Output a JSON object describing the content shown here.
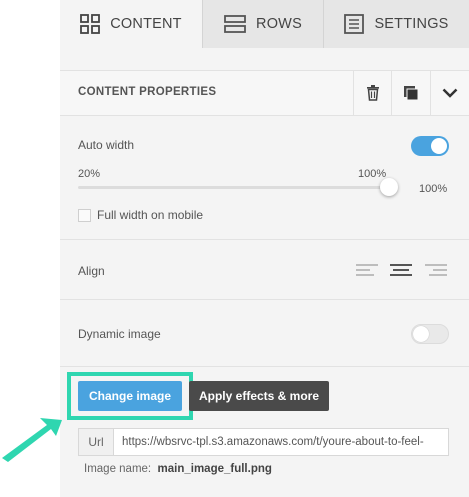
{
  "tabs": [
    {
      "label": "CONTENT",
      "icon": "grid-icon",
      "active": true
    },
    {
      "label": "ROWS",
      "icon": "rows-icon",
      "active": false
    },
    {
      "label": "SETTINGS",
      "icon": "settings-icon",
      "active": false
    }
  ],
  "panel": {
    "title": "CONTENT PROPERTIES",
    "actions": [
      "trash-icon",
      "duplicate-icon",
      "chevron-down-icon"
    ]
  },
  "auto_width": {
    "label": "Auto width",
    "enabled": true,
    "slider_min_label": "20%",
    "slider_max_label": "100%",
    "value_label": "100%",
    "value_fraction": 1.0
  },
  "full_width_mobile": {
    "label": "Full width on mobile",
    "checked": false
  },
  "align": {
    "label": "Align",
    "options": [
      "align-left-icon",
      "align-center-icon",
      "align-right-icon"
    ],
    "selected": "center"
  },
  "dynamic_image": {
    "label": "Dynamic image",
    "enabled": false
  },
  "buttons": {
    "change_image": "Change image",
    "apply_effects": "Apply effects & more"
  },
  "url": {
    "label": "Url",
    "value": "https://wbsrvc-tpl.s3.amazonaws.com/t/youre-about-to-feel-"
  },
  "image_name": {
    "label": "Image name:",
    "value": "main_image_full.png"
  },
  "colors": {
    "accent": "#4aa3df",
    "highlight": "#2fd6b0",
    "dark_button": "#4a4a4a"
  }
}
